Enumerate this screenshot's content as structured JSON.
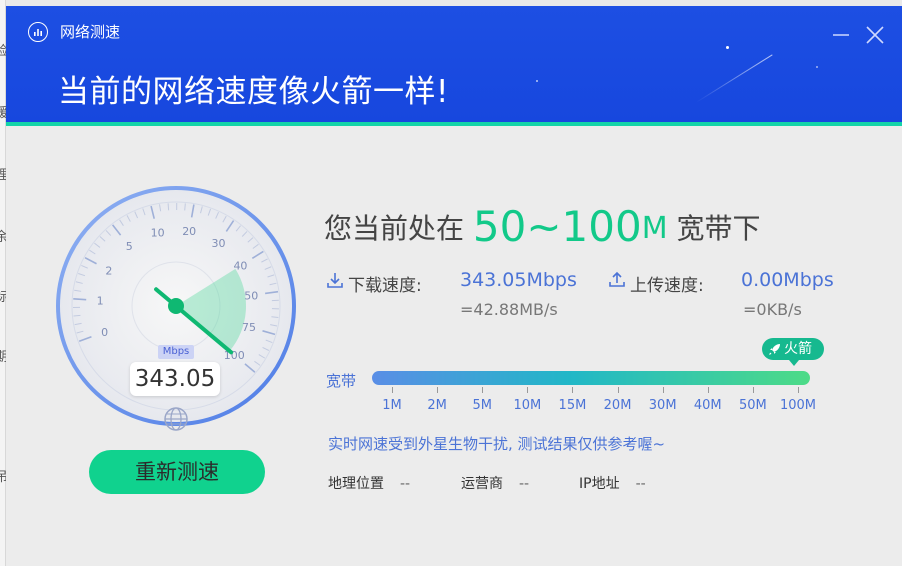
{
  "background_fragments": [
    "检",
    "缓",
    "理",
    "余",
    "标",
    "期",
    "吊"
  ],
  "window": {
    "app_title": "网络测速",
    "headline": "当前的网络速度像火箭一样!",
    "accent_color": "#1d4fe3",
    "success_color": "#10d28e"
  },
  "gauge": {
    "current_mbps": 343.05,
    "readout": "343.05",
    "unit": "Mbps",
    "tick_labels": [
      "0",
      "1",
      "2",
      "5",
      "10",
      "20",
      "30",
      "40",
      "50",
      "75",
      "100"
    ],
    "needle_tick": "100"
  },
  "retest_label": "重新测速",
  "status": {
    "prefix": "您当前处在",
    "range": "50~100",
    "range_unit": "M",
    "suffix": "宽带下"
  },
  "download": {
    "label": "下载速度:",
    "value": "343.05Mbps",
    "bytes": "=42.88MB/s"
  },
  "upload": {
    "label": "上传速度:",
    "value": "0.00Mbps",
    "bytes": "=0KB/s"
  },
  "bandwidth": {
    "label": "宽带",
    "ticks": [
      "1M",
      "2M",
      "5M",
      "10M",
      "15M",
      "20M",
      "30M",
      "40M",
      "50M",
      "100M"
    ],
    "level_badge": "火箭",
    "level_fraction": 1.0
  },
  "note": "实时网速受到外星生物干扰, 测试结果仅供参考喔~",
  "info": {
    "location_label": "地理位置",
    "location_value": "--",
    "isp_label": "运营商",
    "isp_value": "--",
    "ip_label": "IP地址",
    "ip_value": "--"
  },
  "icons": [
    "speedometer-icon",
    "minimize-icon",
    "close-icon",
    "download-icon",
    "upload-icon",
    "rocket-icon",
    "globe-icon"
  ]
}
